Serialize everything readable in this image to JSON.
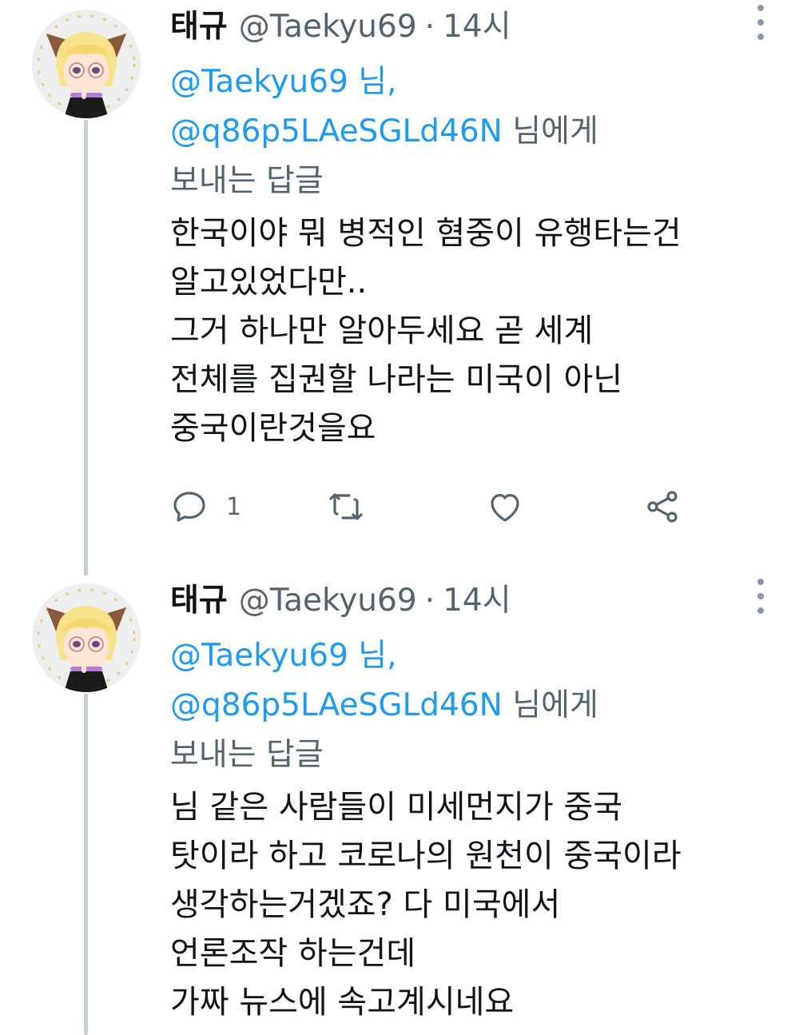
{
  "tweets": [
    {
      "author_name": "태규",
      "author_handle": "@Taekyu69",
      "separator": "·",
      "time": "14시",
      "reply_to": {
        "mention_1": "@Taekyu69",
        "mention_1_suffix": " 님,",
        "mention_2": "@q86p5LAeSGLd46N",
        "mention_2_suffix": " 님에게",
        "line_3": "보내는 답글"
      },
      "text_lines": [
        "한국이야 뭐 병적인 혐중이 유행타는건",
        "알고있었다만..",
        "그거 하나만 알아두세요 곧 세계",
        "전체를 집권할 나라는 미국이 아닌",
        "중국이란것을요"
      ],
      "reply_count": "1",
      "icons": {
        "reply": "comment-icon",
        "retweet": "retweet-icon",
        "like": "heart-icon",
        "share": "share-icon",
        "more": "more-vertical-icon"
      }
    },
    {
      "author_name": "태규",
      "author_handle": "@Taekyu69",
      "separator": "·",
      "time": "14시",
      "reply_to": {
        "mention_1": "@Taekyu69",
        "mention_1_suffix": " 님,",
        "mention_2": "@q86p5LAeSGLd46N",
        "mention_2_suffix": " 님에게",
        "line_3": "보내는 답글"
      },
      "text_lines": [
        "님 같은 사람들이 미세먼지가 중국",
        "탓이라 하고 코로나의 원천이 중국이라",
        "생각하는거겠죠? 다 미국에서",
        "언론조작 하는건데",
        "가짜 뉴스에 속고계시네요"
      ]
    }
  ],
  "colors": {
    "link": "#1d9bf0",
    "secondary": "#536471",
    "text": "#0f1419",
    "thread_line": "#c4cfd6"
  }
}
